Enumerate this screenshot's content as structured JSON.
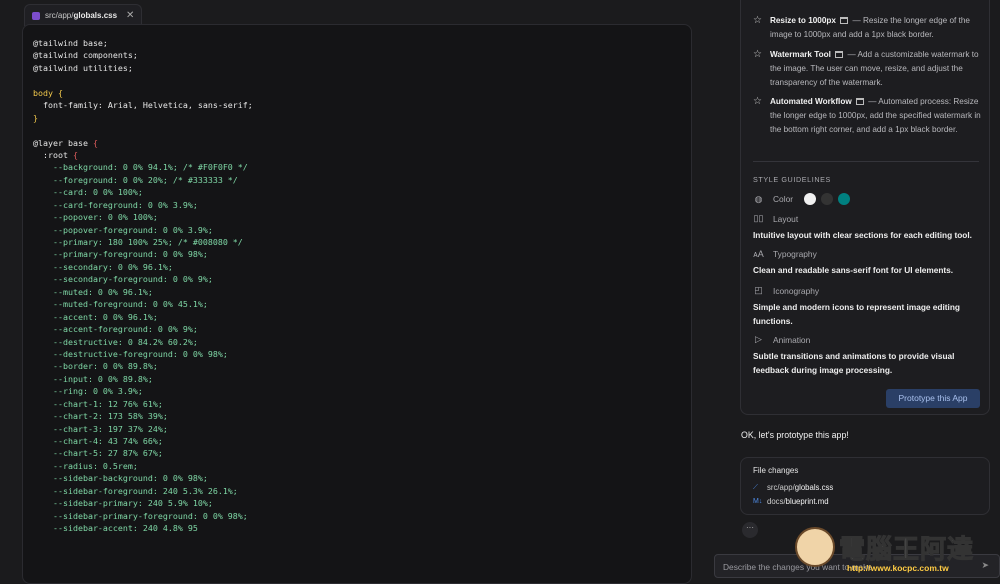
{
  "editor": {
    "tab": {
      "path_prefix": "src/app/",
      "file_name": "globals.css",
      "close_label": "✕"
    },
    "code": [
      [
        {
          "t": "@tailwind base;",
          "c": "c-at"
        }
      ],
      [
        {
          "t": "@tailwind components;",
          "c": "c-at"
        }
      ],
      [
        {
          "t": "@tailwind utilities;",
          "c": "c-at"
        }
      ],
      [],
      [
        {
          "t": "body ",
          "c": "c-sel"
        },
        {
          "t": "{",
          "c": "c-brace"
        }
      ],
      [
        {
          "t": "  font-family: Arial, Helvetica, sans-serif;",
          "c": "c-prop"
        }
      ],
      [
        {
          "t": "}",
          "c": "c-brace"
        }
      ],
      [],
      [
        {
          "t": "@layer base ",
          "c": "c-at"
        },
        {
          "t": "{",
          "c": "c-brace2"
        }
      ],
      [
        {
          "t": "  :root ",
          "c": "c-prop"
        },
        {
          "t": "{",
          "c": "c-brace2"
        }
      ],
      [
        {
          "t": "    --background: 0 0% 94.1%; /* #F0F0F0 */",
          "c": "c-var"
        }
      ],
      [
        {
          "t": "    --foreground: 0 0% 20%; /* #333333 */",
          "c": "c-var"
        }
      ],
      [
        {
          "t": "    --card: 0 0% 100%;",
          "c": "c-var"
        }
      ],
      [
        {
          "t": "    --card-foreground: 0 0% 3.9%;",
          "c": "c-var"
        }
      ],
      [
        {
          "t": "    --popover: 0 0% 100%;",
          "c": "c-var"
        }
      ],
      [
        {
          "t": "    --popover-foreground: 0 0% 3.9%;",
          "c": "c-var"
        }
      ],
      [
        {
          "t": "    --primary: 180 100% 25%; /* #008080 */",
          "c": "c-var"
        }
      ],
      [
        {
          "t": "    --primary-foreground: 0 0% 98%;",
          "c": "c-var"
        }
      ],
      [
        {
          "t": "    --secondary: 0 0% 96.1%;",
          "c": "c-var"
        }
      ],
      [
        {
          "t": "    --secondary-foreground: 0 0% 9%;",
          "c": "c-var"
        }
      ],
      [
        {
          "t": "    --muted: 0 0% 96.1%;",
          "c": "c-var"
        }
      ],
      [
        {
          "t": "    --muted-foreground: 0 0% 45.1%;",
          "c": "c-var"
        }
      ],
      [
        {
          "t": "    --accent: 0 0% 96.1%;",
          "c": "c-var"
        }
      ],
      [
        {
          "t": "    --accent-foreground: 0 0% 9%;",
          "c": "c-var"
        }
      ],
      [
        {
          "t": "    --destructive: 0 84.2% 60.2%;",
          "c": "c-var"
        }
      ],
      [
        {
          "t": "    --destructive-foreground: 0 0% 98%;",
          "c": "c-var"
        }
      ],
      [
        {
          "t": "    --border: 0 0% 89.8%;",
          "c": "c-var"
        }
      ],
      [
        {
          "t": "    --input: 0 0% 89.8%;",
          "c": "c-var"
        }
      ],
      [
        {
          "t": "    --ring: 0 0% 3.9%;",
          "c": "c-var"
        }
      ],
      [
        {
          "t": "    --chart-1: 12 76% 61%;",
          "c": "c-var"
        }
      ],
      [
        {
          "t": "    --chart-2: 173 58% 39%;",
          "c": "c-var"
        }
      ],
      [
        {
          "t": "    --chart-3: 197 37% 24%;",
          "c": "c-var"
        }
      ],
      [
        {
          "t": "    --chart-4: 43 74% 66%;",
          "c": "c-var"
        }
      ],
      [
        {
          "t": "    --chart-5: 27 87% 67%;",
          "c": "c-var"
        }
      ],
      [
        {
          "t": "    --radius: 0.5rem;",
          "c": "c-var"
        }
      ],
      [
        {
          "t": "    --sidebar-background: 0 0% 98%;",
          "c": "c-var"
        }
      ],
      [
        {
          "t": "    --sidebar-foreground: 240 5.3% 26.1%;",
          "c": "c-var"
        }
      ],
      [
        {
          "t": "    --sidebar-primary: 240 5.9% 10%;",
          "c": "c-var"
        }
      ],
      [
        {
          "t": "    --sidebar-primary-foreground: 0 0% 98%;",
          "c": "c-var"
        }
      ],
      [
        {
          "t": "    --sidebar-accent: 240 4.8% 95",
          "c": "c-var"
        }
      ]
    ]
  },
  "features": [
    {
      "title": "Resize to 1000px",
      "desc": "— Resize the longer edge of the image to 1000px and add a 1px black border."
    },
    {
      "title": "Watermark Tool",
      "desc": "— Add a customizable watermark to the image. The user can move, resize, and adjust the transparency of the watermark."
    },
    {
      "title": "Automated Workflow",
      "desc": "— Automated process: Resize the longer edge to 1000px, add the specified watermark in the bottom right corner, and add a 1px black border."
    }
  ],
  "style_guidelines": {
    "title": "STYLE GUIDELINES",
    "color_label": "Color",
    "colors": [
      "#F0F0F0",
      "#333333",
      "#008080"
    ],
    "items": [
      {
        "label": "Layout",
        "icon": "layout-icon",
        "glyph": "▯▯",
        "desc": "Intuitive layout with clear sections for each editing tool."
      },
      {
        "label": "Typography",
        "icon": "typography-icon",
        "glyph": "ᴀA",
        "desc": "Clean and readable sans-serif font for UI elements."
      },
      {
        "label": "Iconography",
        "icon": "image-icon",
        "glyph": "◰",
        "desc": "Simple and modern icons to represent image editing functions."
      },
      {
        "label": "Animation",
        "icon": "play-icon",
        "glyph": "▷",
        "desc": "Subtle transitions and animations to provide visual feedback during image processing."
      }
    ],
    "palette_glyph": "◍"
  },
  "prototype_button": "Prototype this App",
  "assistant_message": "OK, let's prototype this app!",
  "file_changes": {
    "title": "File changes",
    "files": [
      {
        "icon": "⟋",
        "prefix": "src/app/",
        "name": "globals.css"
      },
      {
        "icon": "M↓",
        "prefix": "docs/",
        "name": "blueprint.md"
      }
    ]
  },
  "more_label": "···",
  "chat_input": {
    "placeholder": "Describe the changes you want to make",
    "send_glyph": "➤"
  },
  "watermark": {
    "brand": "電腦王阿達",
    "url": "http://www.kocpc.com.tw"
  }
}
